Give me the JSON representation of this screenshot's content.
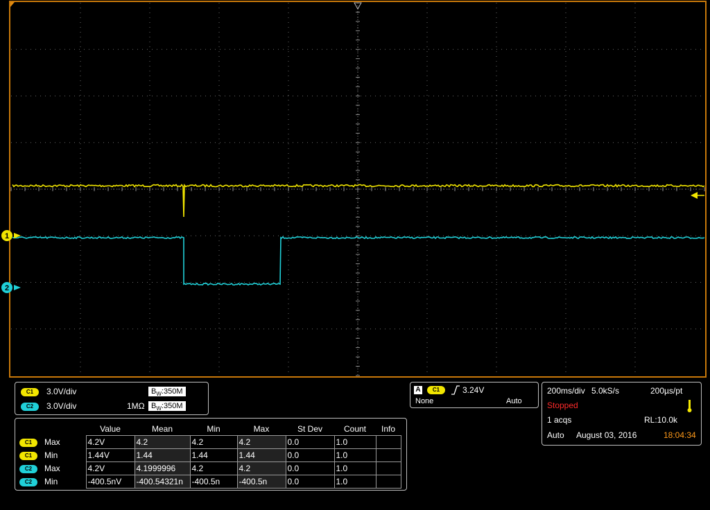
{
  "colors": {
    "ch1": "#f2e600",
    "ch2": "#20d0d8",
    "frame": "#c8780a",
    "grid": "#6a6a6a",
    "stopped": "#ff2a2a",
    "time": "#ff9a1a"
  },
  "markers": {
    "ch1": "1",
    "ch2": "2"
  },
  "channels": [
    {
      "badge": "C1",
      "scale": "3.0V/div",
      "coupling": "",
      "bw": "350M"
    },
    {
      "badge": "C2",
      "scale": "3.0V/div",
      "coupling": "1MΩ",
      "bw": "350M"
    }
  ],
  "bw_prefix": "B",
  "bw_sub": "W",
  "trigger": {
    "mode_letter": "A",
    "source": "C1",
    "level": "3.24V",
    "coupling": "None",
    "mode": "Auto"
  },
  "acq": {
    "timebase": "200ms/div",
    "sample_rate": "5.0kS/s",
    "resolution": "200µs/pt",
    "status": "Stopped",
    "acqs": "1 acqs",
    "record_length": "RL:10.0k",
    "run_mode": "Auto",
    "date": "August 03, 2016",
    "time": "18:04:34"
  },
  "measurements": {
    "headers": [
      "Value",
      "Mean",
      "Min",
      "Max",
      "St Dev",
      "Count",
      "Info"
    ],
    "rows": [
      {
        "badge": "C1",
        "type": "Max",
        "cells": [
          "4.2V",
          "4.2",
          "4.2",
          "4.2",
          "0.0",
          "1.0",
          ""
        ]
      },
      {
        "badge": "C1",
        "type": "Min",
        "cells": [
          "1.44V",
          "1.44",
          "1.44",
          "1.44",
          "0.0",
          "1.0",
          ""
        ]
      },
      {
        "badge": "C2",
        "type": "Max",
        "cells": [
          "4.2V",
          "4.1999996",
          "4.2",
          "4.2",
          "0.0",
          "1.0",
          ""
        ]
      },
      {
        "badge": "C2",
        "type": "Min",
        "cells": [
          "-400.5nV",
          "-400.54321n",
          "-400.5n",
          "-400.5n",
          "0.0",
          "1.0",
          ""
        ]
      }
    ]
  }
}
